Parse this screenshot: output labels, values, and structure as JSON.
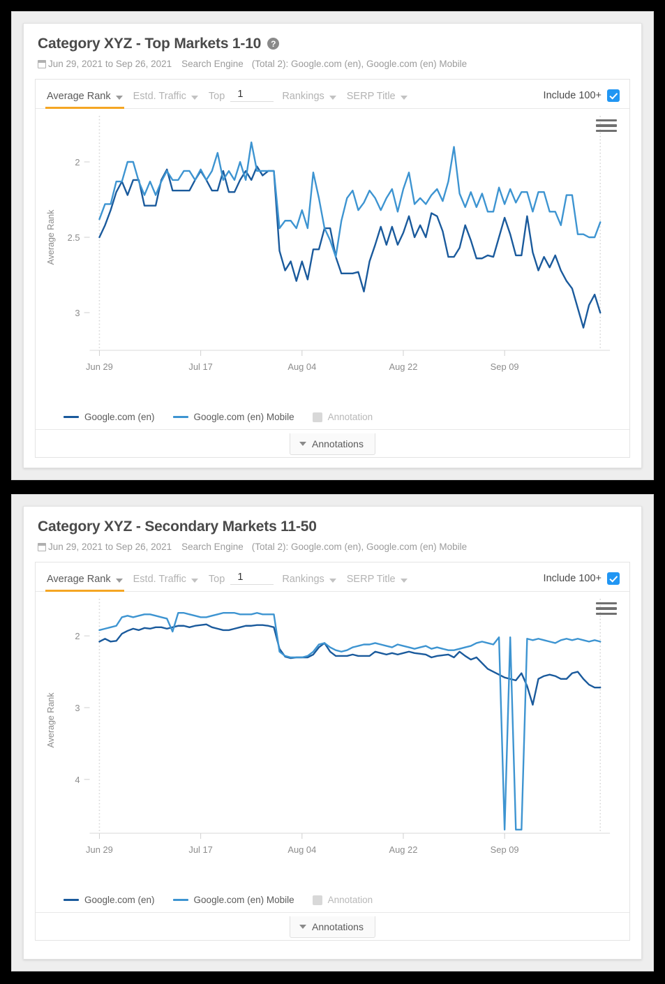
{
  "colors": {
    "series_desktop": "#1a5a9c",
    "series_mobile": "#3d94d1",
    "accent_underline": "#f5a623",
    "checkbox": "#2196f3",
    "annotation_swatch": "#d8d8d8"
  },
  "cards": [
    {
      "title": "Category XYZ - Top Markets 1-10",
      "help_icon": "help-icon",
      "calendar_icon": "calendar-icon",
      "date_range": "Jun 29, 2021 to Sep 26, 2021",
      "meta_label": "Search Engine",
      "meta_value": "(Total 2): Google.com (en), Google.com (en) Mobile",
      "toolbar": {
        "tabs": [
          {
            "label": "Average Rank",
            "active": true
          },
          {
            "label": "Estd. Traffic",
            "active": false
          }
        ],
        "top_label": "Top",
        "top_value": "1",
        "rankings_label": "Rankings",
        "serp_label": "SERP Title",
        "include_label": "Include 100+",
        "include_checked": true
      },
      "menu_icon": "hamburger-menu-icon",
      "legend": [
        {
          "label": "Google.com (en)",
          "type": "line",
          "color": "#1a5a9c"
        },
        {
          "label": "Google.com (en) Mobile",
          "type": "line",
          "color": "#3d94d1"
        },
        {
          "label": "Annotation",
          "type": "swatch",
          "color": "#d8d8d8"
        }
      ],
      "annotations_button": "Annotations",
      "chart_data": {
        "type": "line",
        "title": "Category XYZ - Top Markets 1-10",
        "xlabel": "",
        "ylabel": "Average Rank",
        "y_inverted": true,
        "ylim": [
          1.75,
          3.25
        ],
        "yticks": [
          2,
          2.5,
          3
        ],
        "ytick_labels": [
          "2",
          "2.5",
          "3"
        ],
        "xticks": [
          "Jun 29",
          "Jul 17",
          "Aug 04",
          "Aug 22",
          "Sep 09"
        ],
        "xtick_positions": [
          0,
          18,
          36,
          54,
          72
        ],
        "x_count": 90,
        "grid": false,
        "legend_position": "bottom-left",
        "series": [
          {
            "name": "Google.com (en)",
            "color": "#1a5a9c",
            "values": [
              2.5,
              2.42,
              2.32,
              2.2,
              2.13,
              2.22,
              2.12,
              2.12,
              2.29,
              2.29,
              2.29,
              2.12,
              2.05,
              2.19,
              2.19,
              2.19,
              2.19,
              2.12,
              2.06,
              2.12,
              2.19,
              2.19,
              2.06,
              2.2,
              2.2,
              2.12,
              2.06,
              2.12,
              2.03,
              2.09,
              2.06,
              2.06,
              2.59,
              2.72,
              2.66,
              2.79,
              2.66,
              2.78,
              2.58,
              2.58,
              2.44,
              2.44,
              2.63,
              2.74,
              2.74,
              2.74,
              2.73,
              2.86,
              2.66,
              2.55,
              2.43,
              2.55,
              2.43,
              2.55,
              2.47,
              2.36,
              2.5,
              2.42,
              2.5,
              2.34,
              2.36,
              2.46,
              2.63,
              2.63,
              2.57,
              2.42,
              2.52,
              2.64,
              2.64,
              2.62,
              2.63,
              2.5,
              2.37,
              2.48,
              2.62,
              2.62,
              2.36,
              2.6,
              2.72,
              2.63,
              2.7,
              2.62,
              2.72,
              2.79,
              2.84,
              2.97,
              3.1,
              2.95,
              2.88,
              3.0
            ]
          },
          {
            "name": "Google.com (en) Mobile",
            "color": "#3d94d1",
            "values": [
              2.38,
              2.28,
              2.28,
              2.13,
              2.13,
              2.0,
              2.0,
              2.13,
              2.22,
              2.13,
              2.22,
              2.13,
              2.06,
              2.12,
              2.12,
              2.06,
              2.06,
              2.12,
              2.05,
              2.12,
              2.06,
              1.94,
              2.12,
              2.06,
              2.12,
              2.0,
              2.12,
              1.87,
              2.06,
              2.06,
              2.06,
              2.06,
              2.44,
              2.39,
              2.39,
              2.44,
              2.32,
              2.44,
              2.07,
              2.24,
              2.44,
              2.52,
              2.63,
              2.39,
              2.24,
              2.19,
              2.32,
              2.27,
              2.19,
              2.24,
              2.32,
              2.24,
              2.18,
              2.33,
              2.18,
              2.07,
              2.28,
              2.24,
              2.28,
              2.22,
              2.18,
              2.26,
              2.13,
              1.9,
              2.21,
              2.3,
              2.2,
              2.3,
              2.21,
              2.33,
              2.33,
              2.17,
              2.28,
              2.18,
              2.27,
              2.2,
              2.2,
              2.33,
              2.2,
              2.2,
              2.33,
              2.33,
              2.42,
              2.22,
              2.22,
              2.48,
              2.48,
              2.5,
              2.5,
              2.4
            ]
          }
        ]
      }
    },
    {
      "title": "Category XYZ - Secondary Markets 11-50",
      "help_icon": null,
      "calendar_icon": "calendar-icon",
      "date_range": "Jun 29, 2021 to Sep 26, 2021",
      "meta_label": "Search Engine",
      "meta_value": "(Total 2): Google.com (en), Google.com (en) Mobile",
      "toolbar": {
        "tabs": [
          {
            "label": "Average Rank",
            "active": true
          },
          {
            "label": "Estd. Traffic",
            "active": false
          }
        ],
        "top_label": "Top",
        "top_value": "1",
        "rankings_label": "Rankings",
        "serp_label": "SERP Title",
        "include_label": "Include 100+",
        "include_checked": true
      },
      "menu_icon": "hamburger-menu-icon",
      "legend": [
        {
          "label": "Google.com (en)",
          "type": "line",
          "color": "#1a5a9c"
        },
        {
          "label": "Google.com (en) Mobile",
          "type": "line",
          "color": "#3d94d1"
        },
        {
          "label": "Annotation",
          "type": "swatch",
          "color": "#d8d8d8"
        }
      ],
      "annotations_button": "Annotations",
      "chart_data": {
        "type": "line",
        "title": "Category XYZ - Secondary Markets 11-50",
        "xlabel": "",
        "ylabel": "Average Rank",
        "y_inverted": true,
        "ylim": [
          1.6,
          4.75
        ],
        "yticks": [
          2,
          3,
          4
        ],
        "ytick_labels": [
          "2",
          "3",
          "4"
        ],
        "xticks": [
          "Jun 29",
          "Jul 17",
          "Aug 04",
          "Aug 22",
          "Sep 09"
        ],
        "xtick_positions": [
          0,
          18,
          36,
          54,
          72
        ],
        "x_count": 90,
        "grid": false,
        "legend_position": "bottom-left",
        "series": [
          {
            "name": "Google.com (en)",
            "color": "#1a5a9c",
            "values": [
              2.08,
              2.04,
              2.08,
              2.07,
              1.97,
              1.93,
              1.9,
              1.92,
              1.89,
              1.9,
              1.88,
              1.88,
              1.9,
              1.88,
              1.86,
              1.86,
              1.88,
              1.86,
              1.85,
              1.84,
              1.88,
              1.9,
              1.92,
              1.92,
              1.9,
              1.88,
              1.86,
              1.86,
              1.85,
              1.85,
              1.86,
              1.88,
              2.18,
              2.29,
              2.31,
              2.3,
              2.3,
              2.3,
              2.26,
              2.16,
              2.1,
              2.22,
              2.28,
              2.28,
              2.28,
              2.26,
              2.28,
              2.28,
              2.28,
              2.22,
              2.24,
              2.26,
              2.24,
              2.26,
              2.24,
              2.22,
              2.24,
              2.25,
              2.26,
              2.3,
              2.28,
              2.27,
              2.26,
              2.3,
              2.22,
              2.28,
              2.33,
              2.3,
              2.38,
              2.46,
              2.5,
              2.54,
              2.58,
              2.6,
              2.62,
              2.52,
              2.7,
              2.96,
              2.6,
              2.56,
              2.54,
              2.56,
              2.6,
              2.6,
              2.52,
              2.5,
              2.6,
              2.68,
              2.72,
              2.72
            ]
          },
          {
            "name": "Google.com (en) Mobile",
            "color": "#3d94d1",
            "values": [
              1.92,
              1.9,
              1.88,
              1.86,
              1.74,
              1.72,
              1.74,
              1.72,
              1.7,
              1.7,
              1.72,
              1.74,
              1.76,
              1.94,
              1.68,
              1.68,
              1.7,
              1.72,
              1.74,
              1.74,
              1.72,
              1.7,
              1.68,
              1.68,
              1.68,
              1.7,
              1.7,
              1.7,
              1.68,
              1.7,
              1.7,
              1.7,
              2.22,
              2.28,
              2.3,
              2.3,
              2.3,
              2.28,
              2.22,
              2.12,
              2.1,
              2.16,
              2.2,
              2.22,
              2.2,
              2.16,
              2.14,
              2.12,
              2.12,
              2.1,
              2.12,
              2.14,
              2.16,
              2.12,
              2.14,
              2.16,
              2.18,
              2.16,
              2.14,
              2.18,
              2.16,
              2.18,
              2.2,
              2.2,
              2.18,
              2.16,
              2.14,
              2.1,
              2.08,
              2.1,
              2.12,
              2.02,
              4.7,
              2.02,
              4.7,
              4.7,
              2.04,
              2.06,
              2.04,
              2.06,
              2.08,
              2.1,
              2.06,
              2.04,
              2.06,
              2.04,
              2.06,
              2.08,
              2.06,
              2.08
            ]
          }
        ]
      }
    }
  ]
}
